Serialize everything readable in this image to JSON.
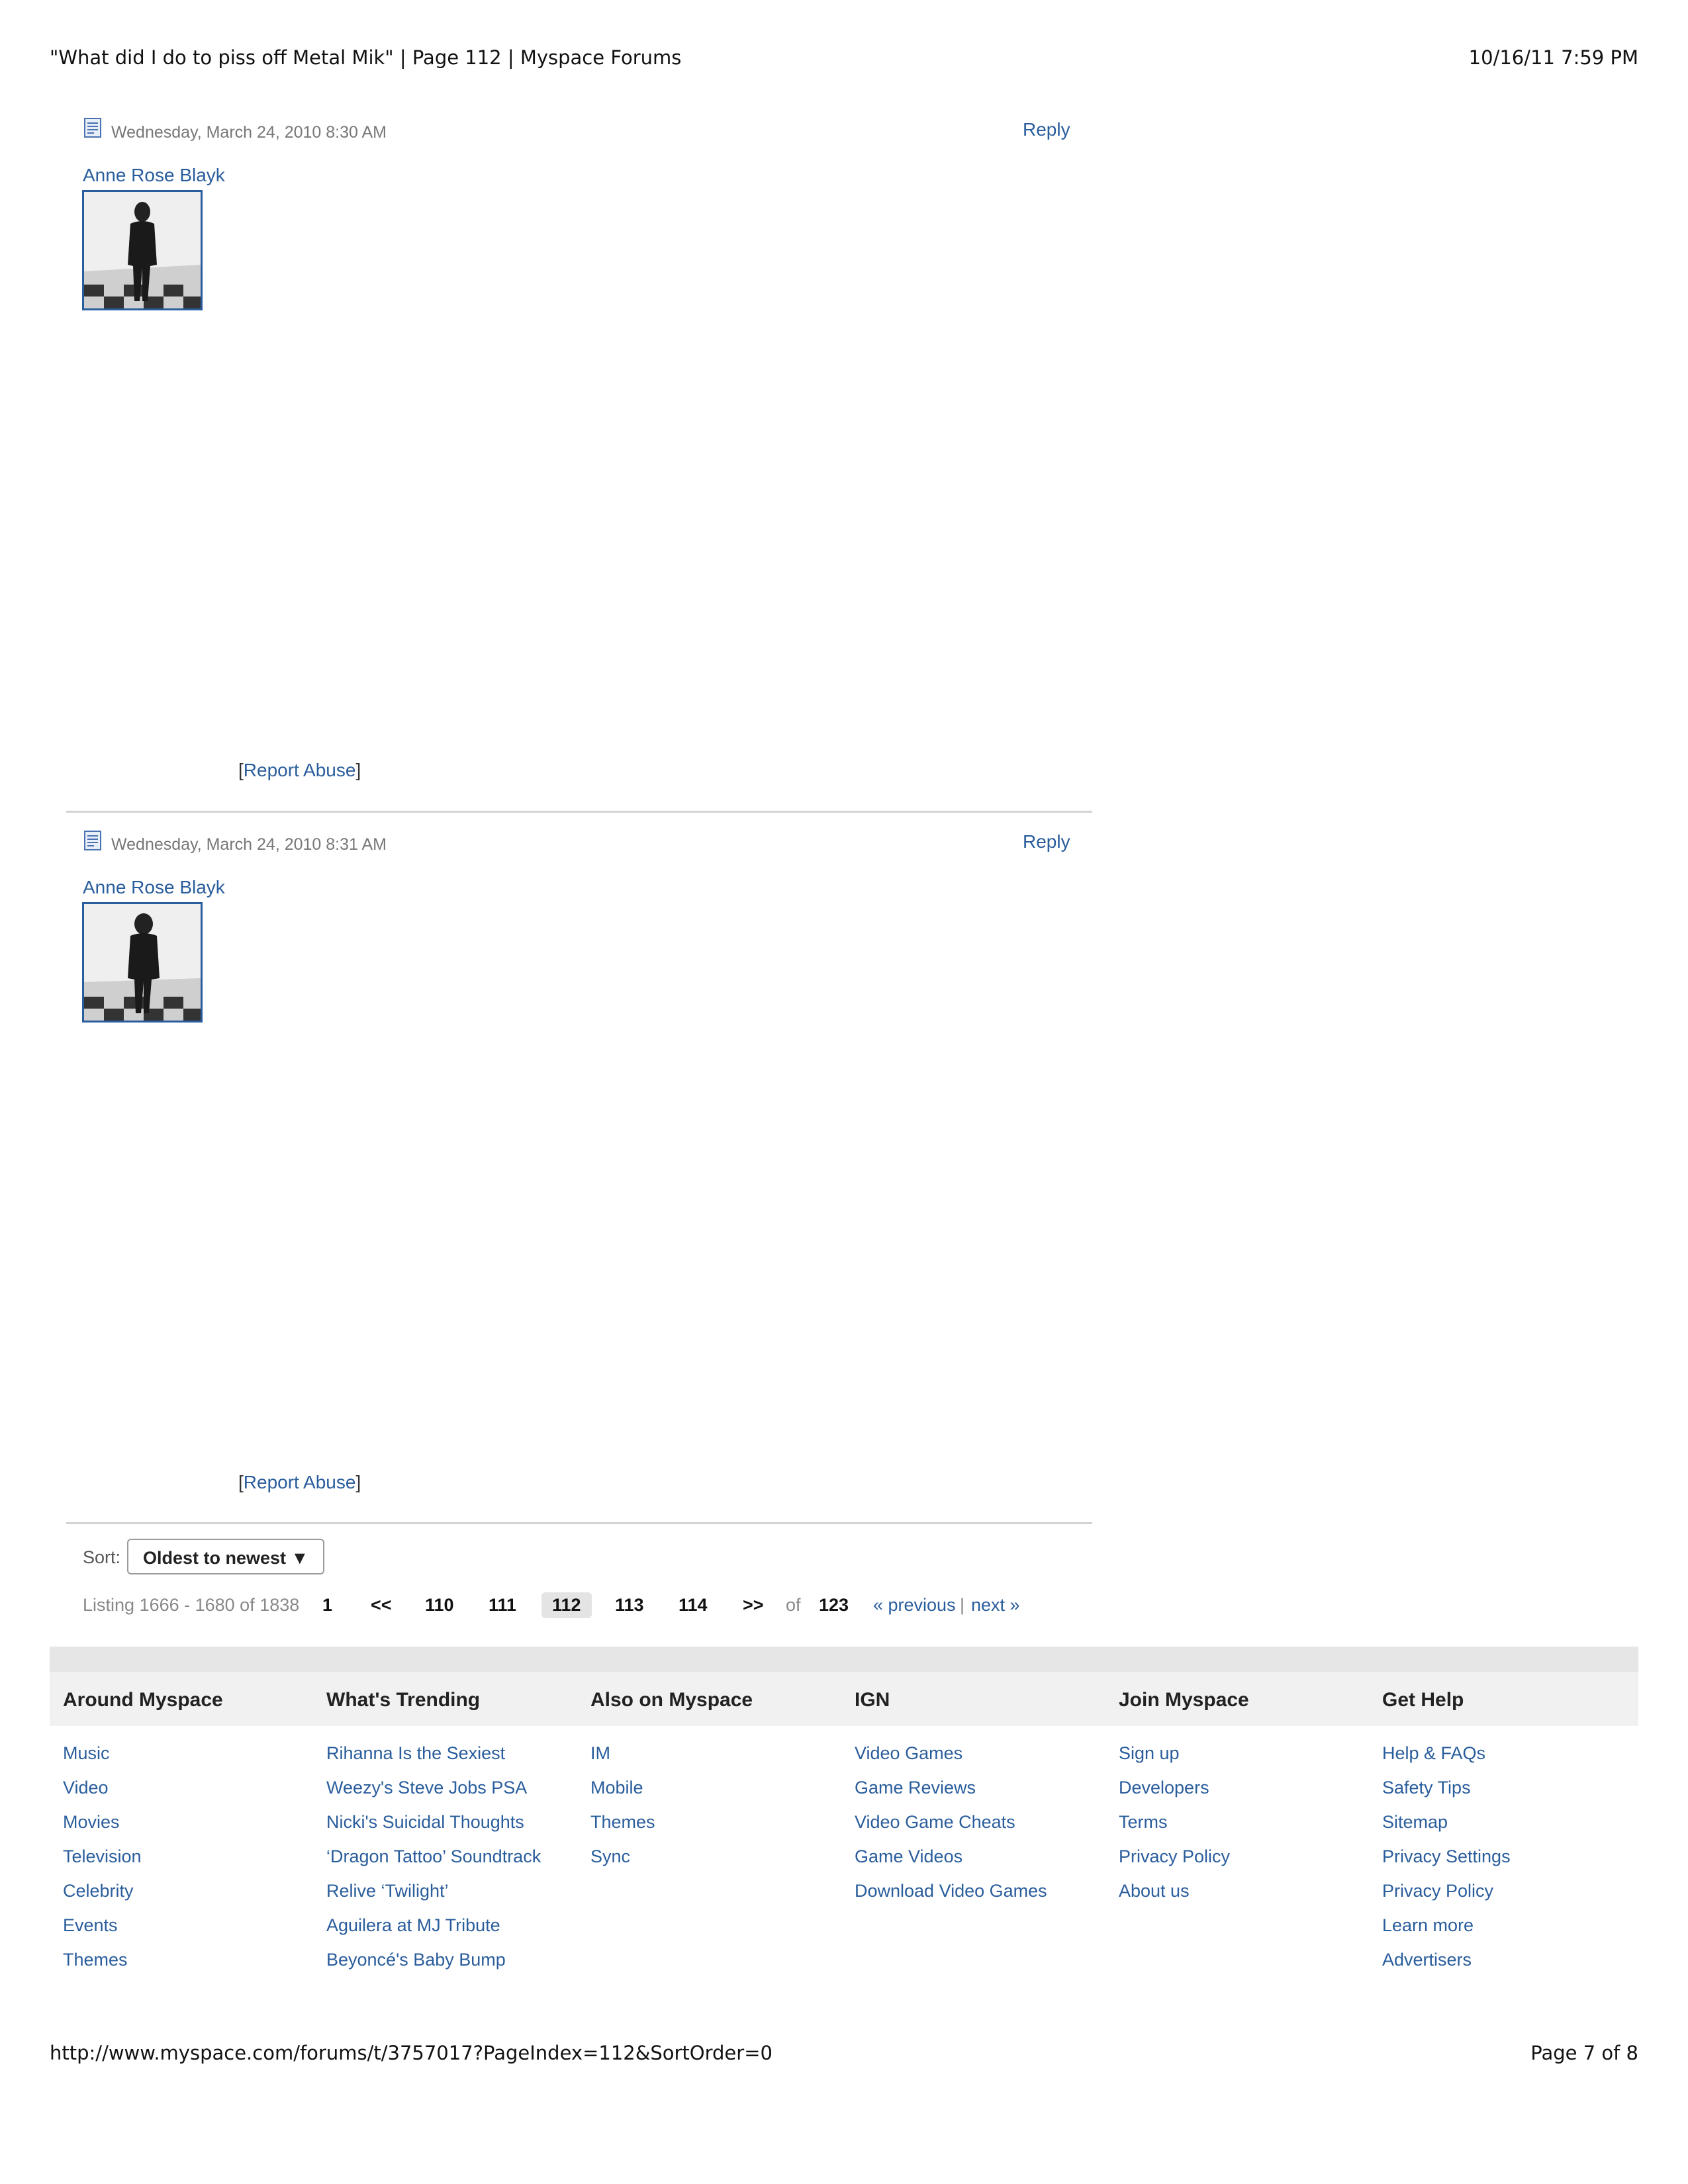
{
  "print_header": {
    "title": "\"What did I do to piss off Metal Mik\" | Page 112 | Myspace Forums",
    "datetime": "10/16/11 7:59 PM"
  },
  "posts": [
    {
      "date": "Wednesday, March 24, 2010 8:30 AM",
      "author": "Anne Rose Blayk",
      "reply_label": "Reply",
      "report_label": "Report Abuse"
    },
    {
      "date": "Wednesday, March 24, 2010 8:31 AM",
      "author": "Anne Rose Blayk",
      "reply_label": "Reply",
      "report_label": "Report Abuse"
    }
  ],
  "sort": {
    "label": "Sort:",
    "selected": "Oldest to newest ▼"
  },
  "pagination": {
    "listing": "Listing 1666 - 1680 of 1838",
    "first": "1",
    "prev_arrows": "<<",
    "pages": [
      "110",
      "111",
      "112",
      "113",
      "114"
    ],
    "current": "112",
    "next_arrows": ">>",
    "of_label": "of",
    "total": "123",
    "previous": "« previous",
    "divider": "|",
    "next": "next »"
  },
  "footer": {
    "columns": [
      {
        "heading": "Around Myspace",
        "items": [
          "Music",
          "Video",
          "Movies",
          "Television",
          "Celebrity",
          "Events",
          "Themes"
        ]
      },
      {
        "heading": "What's Trending",
        "items": [
          "Rihanna Is the Sexiest",
          "Weezy's Steve Jobs PSA",
          "Nicki's Suicidal Thoughts",
          "‘Dragon Tattoo’ Soundtrack",
          "Relive ‘Twilight’",
          "Aguilera at MJ Tribute",
          "Beyoncé's Baby Bump"
        ]
      },
      {
        "heading": "Also on Myspace",
        "items": [
          "IM",
          "Mobile",
          "Themes",
          "Sync"
        ]
      },
      {
        "heading": "IGN",
        "items": [
          "Video Games",
          "Game Reviews",
          "Video Game Cheats",
          "Game Videos",
          "Download Video Games"
        ]
      },
      {
        "heading": "Join Myspace",
        "items": [
          "Sign up",
          "Developers",
          "Terms",
          "Privacy Policy",
          "About us"
        ]
      },
      {
        "heading": "Get Help",
        "items": [
          "Help & FAQs",
          "Safety Tips",
          "Sitemap",
          "Privacy Settings",
          "Privacy Policy",
          "Learn more",
          "Advertisers"
        ]
      }
    ]
  },
  "print_footer": {
    "url": "http://www.myspace.com/forums/t/3757017?PageIndex=112&SortOrder=0",
    "page": "Page 7 of 8"
  }
}
